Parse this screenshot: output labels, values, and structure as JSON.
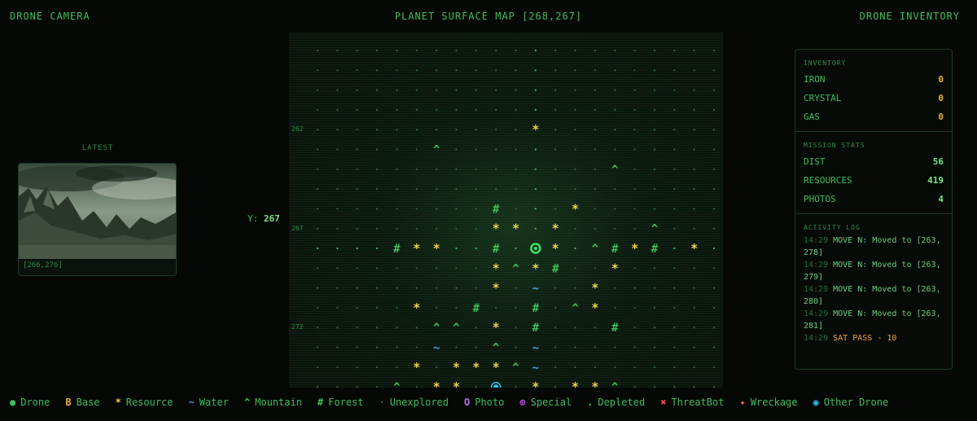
{
  "header": {
    "left": "DRONE CAMERA",
    "center": "PLANET SURFACE MAP [268,267]",
    "right": "DRONE INVENTORY"
  },
  "camera": {
    "latest_label": "LATEST",
    "photo_caption": "[266,276]"
  },
  "map": {
    "y_label": "Y:",
    "y_value": "267",
    "row_labels": [
      "262",
      "267",
      "272"
    ]
  },
  "inventory": {
    "title": "INVENTORY",
    "items": [
      {
        "label": "IRON",
        "value": "0"
      },
      {
        "label": "CRYSTAL",
        "value": "0"
      },
      {
        "label": "GAS",
        "value": "0"
      }
    ]
  },
  "mission": {
    "title": "MISSION STATS",
    "items": [
      {
        "label": "DIST",
        "value": "56"
      },
      {
        "label": "RESOURCES",
        "value": "419"
      },
      {
        "label": "PHOTOS",
        "value": "4"
      }
    ]
  },
  "activity": {
    "title": "ACTIVITY LOG",
    "entries": [
      {
        "time": "14:29",
        "msg": "MOVE N: Moved to [263, 278]"
      },
      {
        "time": "14:29",
        "msg": "MOVE N: Moved to [263, 279]"
      },
      {
        "time": "14:29",
        "msg": "MOVE N: Moved to [263, 280]"
      },
      {
        "time": "14:29",
        "msg": "MOVE N: Moved to [263, 281]"
      },
      {
        "time": "14:29",
        "msg": "SAT PASS - 10"
      }
    ]
  },
  "legend": [
    {
      "symbol": "●",
      "label": "Drone",
      "color": "#3fbf5a",
      "icon": "drone-icon"
    },
    {
      "symbol": "B",
      "label": "Base",
      "color": "#e6b23a",
      "icon": "base-icon"
    },
    {
      "symbol": "*",
      "label": "Resource",
      "color": "#f2d44a",
      "icon": "resource-icon"
    },
    {
      "symbol": "~",
      "label": "Water",
      "color": "#4aa3d8",
      "icon": "water-icon"
    },
    {
      "symbol": "^",
      "label": "Mountain",
      "color": "#3fbf5a",
      "icon": "mountain-icon"
    },
    {
      "symbol": "#",
      "label": "Forest",
      "color": "#3fbf5a",
      "icon": "forest-icon"
    },
    {
      "symbol": "·",
      "label": "Unexplored",
      "color": "#2f6b3e",
      "icon": "unexplored-icon"
    },
    {
      "symbol": "O",
      "label": "Photo",
      "color": "#b070f0",
      "icon": "photo-icon"
    },
    {
      "symbol": "⊕",
      "label": "Special",
      "color": "#c050e0",
      "icon": "special-icon"
    },
    {
      "symbol": ".",
      "label": "Depleted",
      "color": "#3fbf5a",
      "icon": "depleted-icon"
    },
    {
      "symbol": "✖",
      "label": "ThreatBot",
      "color": "#f04848",
      "icon": "threatbot-icon"
    },
    {
      "symbol": "✦",
      "label": "Wreckage",
      "color": "#f07830",
      "icon": "wreckage-icon"
    },
    {
      "symbol": "◉",
      "label": "Other Drone",
      "color": "#30c0e8",
      "icon": "other-drone-icon"
    }
  ],
  "colors": {
    "accent": "#3fbf5a",
    "resource": "#f2d44a",
    "water": "#4aa3d8",
    "inventory_value": "#e6b23a",
    "warn": "#f0a43a",
    "other_drone": "#30c0e8"
  }
}
